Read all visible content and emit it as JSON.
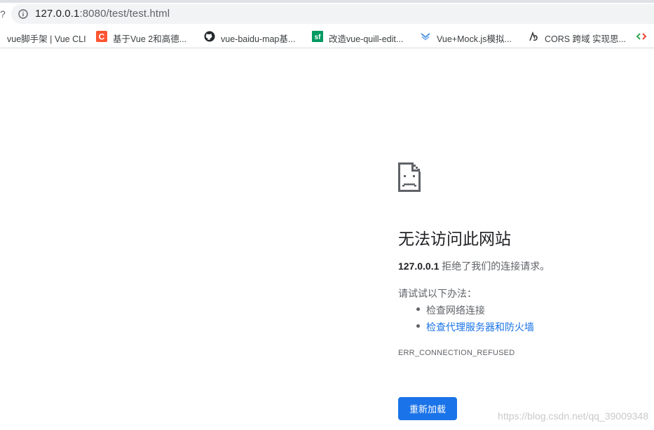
{
  "address_bar": {
    "host": "127.0.0.1",
    "path": ":8080/test/test.html"
  },
  "bookmarks": [
    {
      "label": "vue脚手架 | Vue CLI",
      "icon": "vue-cli-favicon"
    },
    {
      "label": "基于Vue 2和高德...",
      "icon": "csdn-favicon"
    },
    {
      "label": "vue-baidu-map基...",
      "icon": "github-favicon"
    },
    {
      "label": "改造vue-quill-edit...",
      "icon": "segmentfault-favicon"
    },
    {
      "label": "Vue+Mock.js模拟...",
      "icon": "mock-favicon"
    },
    {
      "label": "CORS 跨域 实现思...",
      "icon": "cors-favicon"
    }
  ],
  "error": {
    "title": "无法访问此网站",
    "host": "127.0.0.1",
    "description": " 拒绝了我们的连接请求。",
    "try_label": "请试试以下办法：",
    "suggestions": [
      "检查网络连接",
      "检查代理服务器和防火墙"
    ],
    "code": "ERR_CONNECTION_REFUSED",
    "reload_label": "重新加载"
  },
  "watermark": "https://blog.csdn.net/qq_39009348",
  "colors": {
    "accent": "#1a73e8",
    "text_primary": "#202124",
    "text_secondary": "#5f6368"
  }
}
